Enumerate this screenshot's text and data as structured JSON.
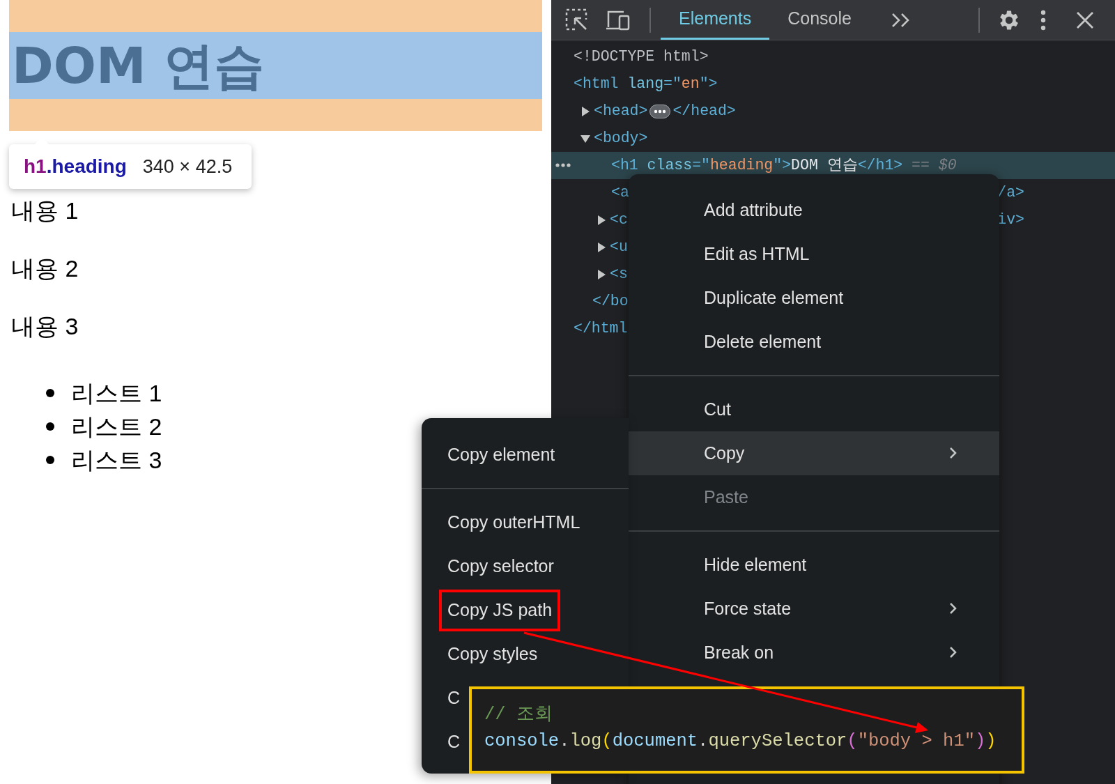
{
  "page": {
    "heading": "DOM 연습",
    "paragraphs": [
      "내용 1",
      "내용 2",
      "내용 3"
    ],
    "list": [
      "리스트 1",
      "리스트 2",
      "리스트 3"
    ]
  },
  "inspect_tooltip": {
    "tag": "h1",
    "class_name": ".heading",
    "size": "340 × 42.5"
  },
  "devtools": {
    "tabs": [
      {
        "label": "Elements",
        "selected": true
      },
      {
        "label": "Console",
        "selected": false
      }
    ],
    "dom_tree": [
      {
        "selected": false,
        "line": [
          {
            "kind": "doctype",
            "text": "<!DOCTYPE html>"
          }
        ]
      },
      {
        "selected": false,
        "line": [
          {
            "kind": "tag",
            "text": "<html "
          },
          {
            "kind": "attr",
            "text": "lang"
          },
          {
            "kind": "tag",
            "text": "=\""
          },
          {
            "kind": "value",
            "text": "en"
          },
          {
            "kind": "tag",
            "text": "\">"
          }
        ],
        "children": [
          {
            "selected": false,
            "expanded": false,
            "line": [
              {
                "kind": "tag",
                "text": "<head>"
              },
              {
                "kind": "badge"
              },
              {
                "kind": "tag",
                "text": "</head>"
              }
            ]
          },
          {
            "selected": false,
            "expanded": true,
            "line": [
              {
                "kind": "tag",
                "text": "<body>"
              }
            ],
            "children": [
              {
                "selected": true,
                "line": [
                  {
                    "kind": "tag",
                    "text": "<h1 "
                  },
                  {
                    "kind": "attr",
                    "text": "class"
                  },
                  {
                    "kind": "tag",
                    "text": "=\""
                  },
                  {
                    "kind": "value",
                    "text": "heading"
                  },
                  {
                    "kind": "tag",
                    "text": "\">"
                  },
                  {
                    "kind": "text",
                    "text": "DOM 연습"
                  },
                  {
                    "kind": "tag",
                    "text": "</h1>"
                  },
                  {
                    "kind": "meta",
                    "text": " == $0"
                  }
                ]
              },
              {
                "selected": false,
                "line": [
                  {
                    "kind": "tag",
                    "text": "<a"
                  }
                ],
                "line_end": [
                  {
                    "kind": "tag",
                    "text": "/a>"
                  }
                ]
              },
              {
                "selected": false,
                "expanded": false,
                "line": [
                  {
                    "kind": "tag",
                    "text": "<c"
                  }
                ],
                "line_end": [
                  {
                    "kind": "tag",
                    "text": "iv>"
                  }
                ]
              },
              {
                "selected": false,
                "expanded": false,
                "line": [
                  {
                    "kind": "tag",
                    "text": "<u"
                  }
                ]
              },
              {
                "selected": false,
                "expanded": false,
                "line": [
                  {
                    "kind": "tag",
                    "text": "<s"
                  }
                ]
              }
            ],
            "closing": [
              {
                "kind": "tag",
                "text": "</bo"
              }
            ]
          }
        ],
        "closing": [
          {
            "kind": "tag",
            "text": "</html"
          }
        ]
      }
    ]
  },
  "context_menu": [
    {
      "kind": "item",
      "label": "Add attribute",
      "selected": false,
      "disabled": false,
      "submenu": false
    },
    {
      "kind": "item",
      "label": "Edit as HTML",
      "selected": false,
      "disabled": false,
      "submenu": false
    },
    {
      "kind": "item",
      "label": "Duplicate element",
      "selected": false,
      "disabled": false,
      "submenu": false
    },
    {
      "kind": "item",
      "label": "Delete element",
      "selected": false,
      "disabled": false,
      "submenu": false
    },
    {
      "kind": "divider"
    },
    {
      "kind": "item",
      "label": "Cut",
      "selected": false,
      "disabled": false,
      "submenu": false
    },
    {
      "kind": "item",
      "label": "Copy",
      "selected": true,
      "disabled": false,
      "submenu": true
    },
    {
      "kind": "item",
      "label": "Paste",
      "selected": false,
      "disabled": true,
      "submenu": false
    },
    {
      "kind": "divider"
    },
    {
      "kind": "item",
      "label": "Hide element",
      "selected": false,
      "disabled": false,
      "submenu": false
    },
    {
      "kind": "item",
      "label": "Force state",
      "selected": false,
      "disabled": false,
      "submenu": true
    },
    {
      "kind": "item",
      "label": "Break on",
      "selected": false,
      "disabled": false,
      "submenu": true
    }
  ],
  "copy_submenu": [
    {
      "kind": "item",
      "label": "Copy element",
      "boxed": false
    },
    {
      "kind": "divider"
    },
    {
      "kind": "item",
      "label": "Copy outerHTML",
      "boxed": false
    },
    {
      "kind": "item",
      "label": "Copy selector",
      "boxed": false
    },
    {
      "kind": "item",
      "label": "Copy JS path",
      "boxed": true
    },
    {
      "kind": "item",
      "label": "Copy styles",
      "boxed": false
    },
    {
      "kind": "item",
      "label": "C",
      "boxed": false
    },
    {
      "kind": "item",
      "label": "C",
      "boxed": false
    }
  ],
  "code_callout": {
    "comment": "// 조회",
    "code": [
      {
        "kind": "variable",
        "text": "console"
      },
      {
        "kind": "punct",
        "text": "."
      },
      {
        "kind": "function",
        "text": "log"
      },
      {
        "kind": "bracket1",
        "text": "("
      },
      {
        "kind": "variable",
        "text": "document"
      },
      {
        "kind": "punct",
        "text": "."
      },
      {
        "kind": "function",
        "text": "querySelector"
      },
      {
        "kind": "bracket2",
        "text": "("
      },
      {
        "kind": "string",
        "text": "\"body > h1\""
      },
      {
        "kind": "bracket2",
        "text": ")"
      },
      {
        "kind": "bracket1",
        "text": ")"
      }
    ]
  }
}
